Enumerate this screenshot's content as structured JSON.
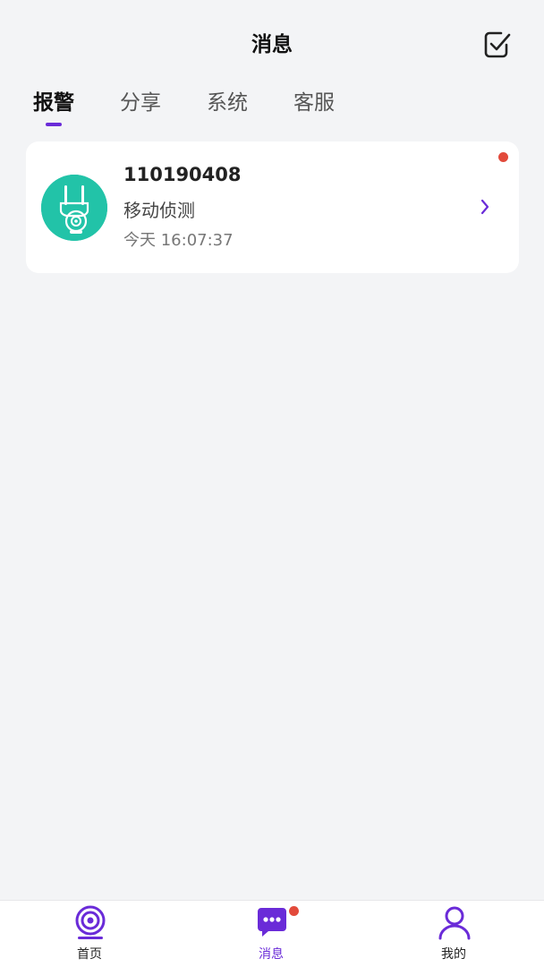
{
  "header": {
    "title": "消息"
  },
  "tabs": [
    {
      "label": "报警",
      "active": true
    },
    {
      "label": "分享",
      "active": false
    },
    {
      "label": "系统",
      "active": false
    },
    {
      "label": "客服",
      "active": false
    }
  ],
  "messages": [
    {
      "device_id": "110190408",
      "event": "移动侦测",
      "time": "今天 16:07:37",
      "unread": true,
      "icon": "camera-icon"
    }
  ],
  "bottom_nav": [
    {
      "label": "首页",
      "icon": "home-camera-icon",
      "active": false
    },
    {
      "label": "消息",
      "icon": "message-icon",
      "active": true,
      "badge": true
    },
    {
      "label": "我的",
      "icon": "profile-icon",
      "active": false
    }
  ],
  "colors": {
    "accent": "#6a2bd8",
    "badge": "#e24a3b",
    "avatar_bg": "#22c3a8",
    "background": "#f3f4f6"
  }
}
